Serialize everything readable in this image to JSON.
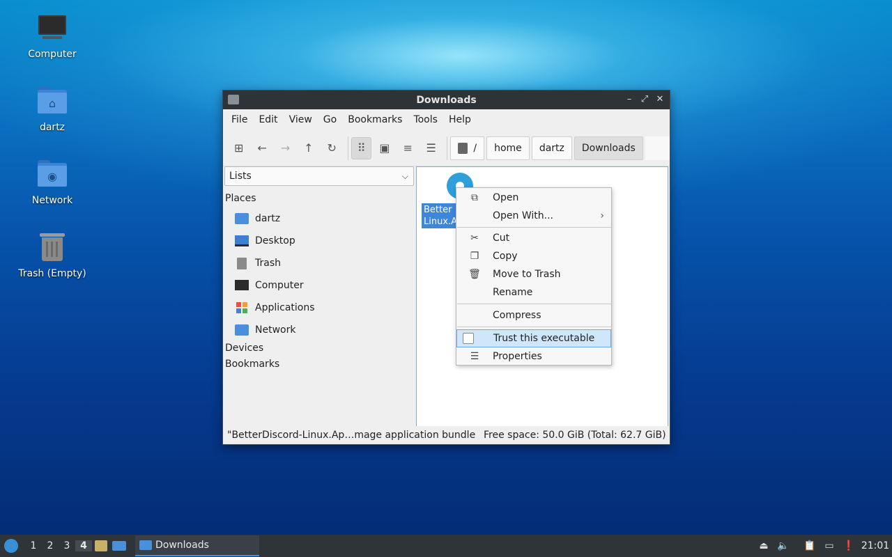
{
  "desktop": {
    "icons": [
      {
        "label": "Computer",
        "icon": "computer-icon"
      },
      {
        "label": "dartz",
        "icon": "home-folder-icon"
      },
      {
        "label": "Network",
        "icon": "network-folder-icon"
      },
      {
        "label": "Trash (Empty)",
        "icon": "trash-icon"
      }
    ]
  },
  "window": {
    "title": "Downloads",
    "controls": {
      "minimize": "–",
      "maximize": "⤢",
      "close": "✕"
    },
    "menu": [
      "File",
      "Edit",
      "View",
      "Go",
      "Bookmarks",
      "Tools",
      "Help"
    ],
    "toolbar": {
      "new_tab": "⊞",
      "back": "←",
      "forward": "→",
      "up": "↑",
      "reload": "↻",
      "icon_view": "⠿",
      "thumb_view": "▣",
      "compact_view": "≡",
      "detail_view": "☰"
    },
    "path": [
      "/",
      "home",
      "dartz",
      "Downloads"
    ],
    "side_panel": {
      "mode": "Lists",
      "places_header": "Places",
      "places": [
        "dartz",
        "Desktop",
        "Trash",
        "Computer",
        "Applications",
        "Network"
      ],
      "devices_header": "Devices",
      "bookmarks_header": "Bookmarks"
    },
    "file": {
      "label_line1": "Better",
      "label_line2": "Linux.A"
    },
    "status": {
      "left": "\"BetterDiscord-Linux.Ap…mage application bundle",
      "right": "Free space: 50.0 GiB (Total: 62.7 GiB)"
    }
  },
  "context_menu": {
    "open": "Open",
    "open_with": "Open With...",
    "cut": "Cut",
    "copy": "Copy",
    "move_to_trash": "Move to Trash",
    "rename": "Rename",
    "compress": "Compress",
    "trust": "Trust this executable",
    "properties": "Properties"
  },
  "taskbar": {
    "workspaces": [
      "1",
      "2",
      "3",
      "4"
    ],
    "active_workspace": "4",
    "task_label": "Downloads",
    "clock": "21:01"
  }
}
